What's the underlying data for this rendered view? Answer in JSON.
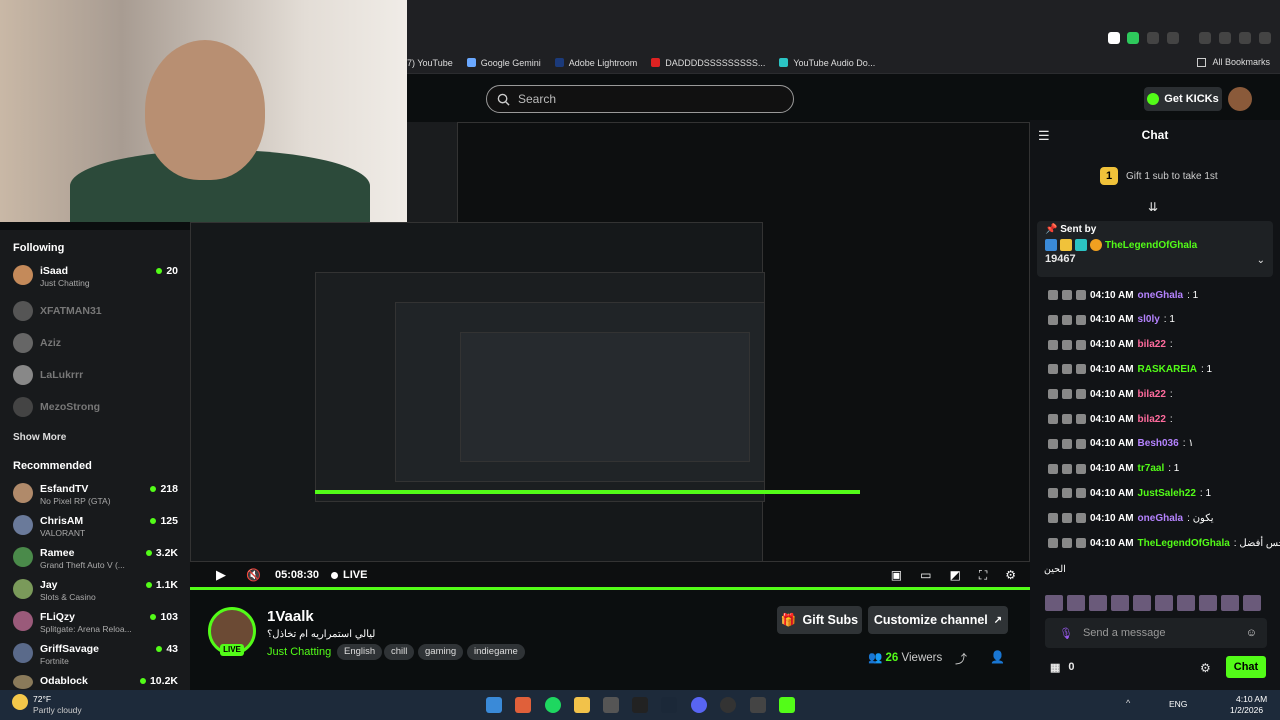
{
  "browser": {
    "bookmarks": [
      "7) YouTube",
      "Google Gemini",
      "Adobe Lightroom",
      "DADDDDSSSSSSSSS...",
      "YouTube Audio Do..."
    ],
    "all_bookmarks": "All Bookmarks"
  },
  "header": {
    "search_placeholder": "Search",
    "get_kicks": "Get KICKs"
  },
  "sidebar": {
    "following_title": "Following",
    "following": [
      {
        "name": "iSaad",
        "sub": "Just Chatting",
        "viewers": "20",
        "live": true
      },
      {
        "name": "XFATMAN31",
        "live": false
      },
      {
        "name": "Aziz",
        "live": false
      },
      {
        "name": "LaLukrrr",
        "live": false
      },
      {
        "name": "MezoStrong",
        "live": false
      }
    ],
    "show_more": "Show More",
    "recommended_title": "Recommended",
    "recommended": [
      {
        "name": "EsfandTV",
        "sub": "No Pixel RP (GTA)",
        "viewers": "218"
      },
      {
        "name": "ChrisAM",
        "sub": "VALORANT",
        "viewers": "125"
      },
      {
        "name": "Ramee",
        "sub": "Grand Theft Auto V (...",
        "viewers": "3.2K"
      },
      {
        "name": "Jay",
        "sub": "Slots & Casino",
        "viewers": "1.1K"
      },
      {
        "name": "FLiQzy",
        "sub": "Splitgate: Arena Reloa...",
        "viewers": "103"
      },
      {
        "name": "GriffSavage",
        "sub": "Fortnite",
        "viewers": "43"
      },
      {
        "name": "Odablock",
        "sub": "",
        "viewers": "10.2K"
      }
    ]
  },
  "player": {
    "time": "05:08:30",
    "live": "LIVE"
  },
  "channel": {
    "name": "1Vaalk",
    "title": "ليالي استمراريه ام تخاذل؟",
    "category": "Just Chatting",
    "tags": [
      "English",
      "chill",
      "gaming",
      "indiegame"
    ],
    "live_badge": "LIVE",
    "gift_subs": "Gift Subs",
    "customize": "Customize channel",
    "viewers_count": "26",
    "viewers_label": "Viewers"
  },
  "chat": {
    "title": "Chat",
    "gift_prompt": "Gift 1 sub to take 1st",
    "pinned": {
      "label": "Sent by",
      "user": "TheLegendOfGhala",
      "count": "19467"
    },
    "messages": [
      {
        "time": "04:10 AM",
        "user": "oneGhala",
        "text": ": 1",
        "color": "#b583ff"
      },
      {
        "time": "04:10 AM",
        "user": "sl0ly",
        "text": ": 1",
        "color": "#b583ff"
      },
      {
        "time": "04:10 AM",
        "user": "bila22",
        "text": ":",
        "color": "#ff6b9d"
      },
      {
        "time": "04:10 AM",
        "user": "RASKAREIA",
        "text": ": 1",
        "color": "#53fc18"
      },
      {
        "time": "04:10 AM",
        "user": "bila22",
        "text": ":",
        "color": "#ff6b9d"
      },
      {
        "time": "04:10 AM",
        "user": "bila22",
        "text": ":",
        "color": "#ff6b9d"
      },
      {
        "time": "04:10 AM",
        "user": "Besh036",
        "text": ": ١",
        "color": "#b583ff"
      },
      {
        "time": "04:10 AM",
        "user": "tr7aal",
        "text": ": 1",
        "color": "#53fc18"
      },
      {
        "time": "04:10 AM",
        "user": "JustSaleh22",
        "text": ": 1",
        "color": "#53fc18"
      },
      {
        "time": "04:10 AM",
        "user": "oneGhala",
        "text": ": يكون",
        "color": "#b583ff"
      },
      {
        "time": "04:10 AM",
        "user": "TheLegendOfGhala",
        "text": ": إني أحس أفضل",
        "color": "#53fc18"
      }
    ],
    "last_line": "الحين",
    "input_placeholder": "Send a message",
    "kicks_count": "0",
    "send": "Chat"
  },
  "taskbar": {
    "temp": "72°F",
    "weather": "Partly cloudy",
    "lang": "ENG",
    "time": "4:10 AM",
    "date": "1/2/2026"
  },
  "colors": {
    "accent": "#53fc18",
    "bg": "#0b0e0f",
    "panel": "#181a1c"
  }
}
